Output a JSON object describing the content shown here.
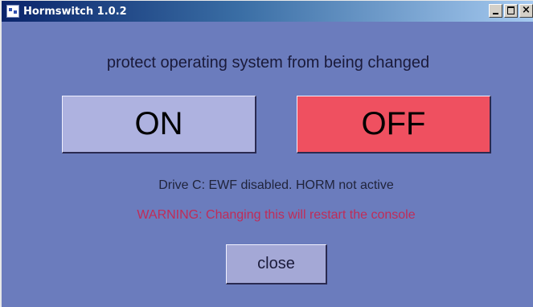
{
  "window": {
    "title": "Hormswitch 1.0.2",
    "controls": {
      "minimize": "_",
      "maximize": "□",
      "close": "×"
    }
  },
  "main": {
    "subtitle": "protect operating system from being changed",
    "on_label": "ON",
    "off_label": "OFF",
    "status_text": "Drive C: EWF disabled. HORM not active",
    "warning_text": "WARNING: Changing this will restart the console",
    "close_label": "close"
  },
  "colors": {
    "background": "#6b7cbd",
    "on_button": "#aeb2e0",
    "off_button": "#ef5060",
    "warning": "#c02c58"
  },
  "icons": [
    "app-icon",
    "minimize-icon",
    "maximize-icon",
    "close-icon"
  ]
}
